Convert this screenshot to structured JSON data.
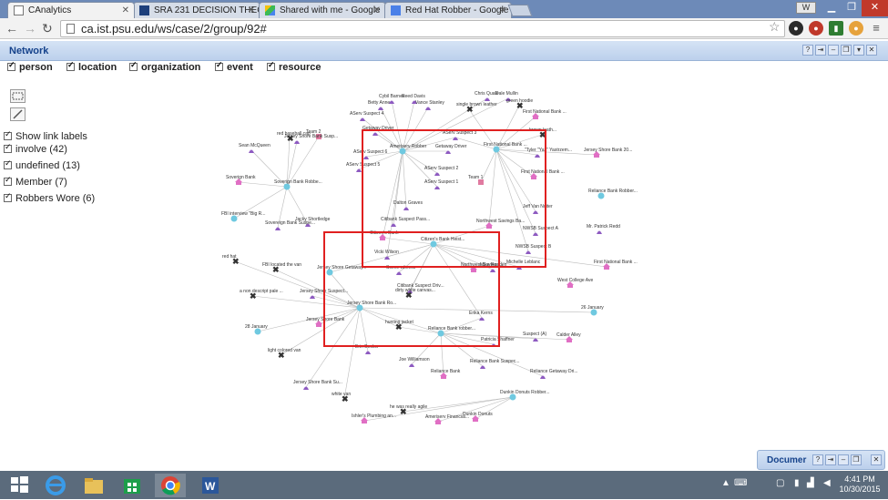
{
  "browser": {
    "tabs": [
      {
        "label": "CAnalytics",
        "active": true
      },
      {
        "label": "SRA 231 DECISION THEO",
        "active": false
      },
      {
        "label": "Shared with me - Google",
        "active": false
      },
      {
        "label": "Red Hat Robber - Google",
        "active": false
      }
    ],
    "user_badge": "W",
    "url": "ca.ist.psu.edu/ws/case/2/group/92#"
  },
  "panel": {
    "title": "Network",
    "filters": [
      "person",
      "location",
      "organization",
      "event",
      "resource"
    ],
    "options": [
      "Show link labels",
      "involve (42)",
      "undefined (13)",
      "Member (7)",
      "Robbers Wore (6)"
    ]
  },
  "graph": {
    "labels": [
      "Cybil Barnes",
      "Reed Davis",
      "Chris Quale",
      "Dale Mullin",
      "green hoodie",
      "Betty Anne",
      "Vance Stanley",
      "single brown leather",
      "First National Bank ...",
      "AServ Suspect 4",
      "brown leath...",
      "Team 2",
      "red baseball cap",
      "Jersey Shore Bank Susp...",
      "Getaway Driver",
      "Jersey Shore Bank 20...",
      "AServ Suspect 3",
      "Sean McQueen",
      "Ameriserv Robber",
      "Getaway Driver",
      "First National Bank ...",
      "AServ Suspect 6",
      "\"Tyler \"Yaz\" Yastrzem...",
      "AServ Suspect 5",
      "AServ Suspect 2",
      "Team 1",
      "Soverign Bank",
      "Soverign Bank Robbe...",
      "First National Bank ...",
      "AServ Suspect 1",
      "Reliance Bank Robber...",
      "Dalton Graves",
      "Jeff Van Nuiter",
      "FBI interview \"Big R...",
      "Citibank Suspect Pass...",
      "Jacky Shortledge",
      "Sovereign Bank Suspe...",
      "Northwest Savings Ba...",
      "NWSB Suspect A",
      "Mr. Patrick Redd",
      "Citizen's Bank",
      "Citizen's Bank Heist...",
      "NWSB Suspect B",
      "red hat",
      "Vicki Wilson",
      "First National Bank ...",
      "FBI located the van",
      "Jersey Shore Getaway...",
      "Northwest Savings...",
      "Mike Redden",
      "Michelle Leblanc",
      "Scene witness",
      "West College Ave",
      "a non descript pale ...",
      "Jersey Shore Suspect...",
      "Citibank Suspect Driv...",
      "dirty white canvas...",
      "Jersey Shore Bank Ro...",
      "26 January",
      "28 January",
      "Jersey Shore Bank",
      "hunting jacket",
      "Reliance Bank robber...",
      "Erika Kerns",
      "Patricia Shaffner",
      "Suspect (A)",
      "Calder Alley",
      "Erin Becker",
      "light colored van",
      "Joe Williamson",
      "Reliance Bank Suspec...",
      "Reliance Bank",
      "Reliance Getaway Dri...",
      "Jersey Shore Bank Su...",
      "white van",
      "Dunkin Donuts Robber...",
      "he was really agile",
      "Ishler's Plumbing an...",
      "Ameriserv Financial...",
      "Dunkin Donuts"
    ]
  },
  "doc_panel": {
    "title": "Documer"
  },
  "clock": {
    "time": "4:41 PM",
    "date": "10/30/2015"
  }
}
